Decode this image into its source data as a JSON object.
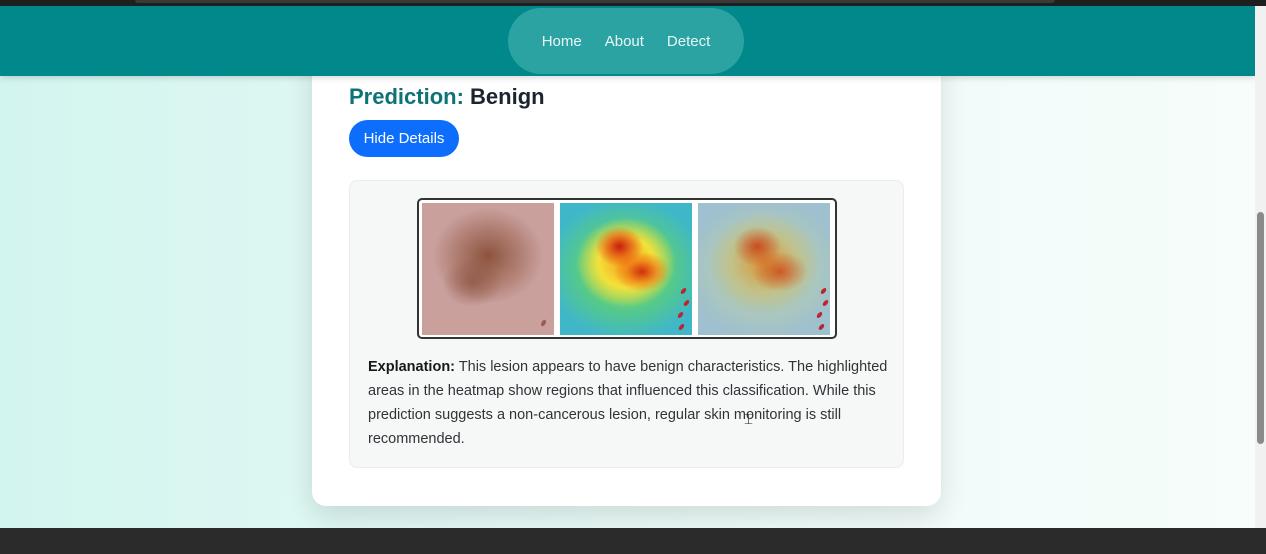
{
  "nav": {
    "links": [
      "Home",
      "About",
      "Detect"
    ]
  },
  "result": {
    "prediction_label": "Prediction:",
    "prediction_value": "Benign",
    "hide_button": "Hide Details"
  },
  "explanation": {
    "label": "Explanation:",
    "text": " This lesion appears to have benign characteristics. The highlighted areas in the heatmap show regions that influenced this classification. While this prediction suggests a non-cancerous lesion, regular skin monitoring is still recommended."
  },
  "colors": {
    "navbar": "#00888a",
    "nav_pill": "#2ba3a3",
    "prediction_label": "#0e7377",
    "button": "#0d6efd"
  }
}
